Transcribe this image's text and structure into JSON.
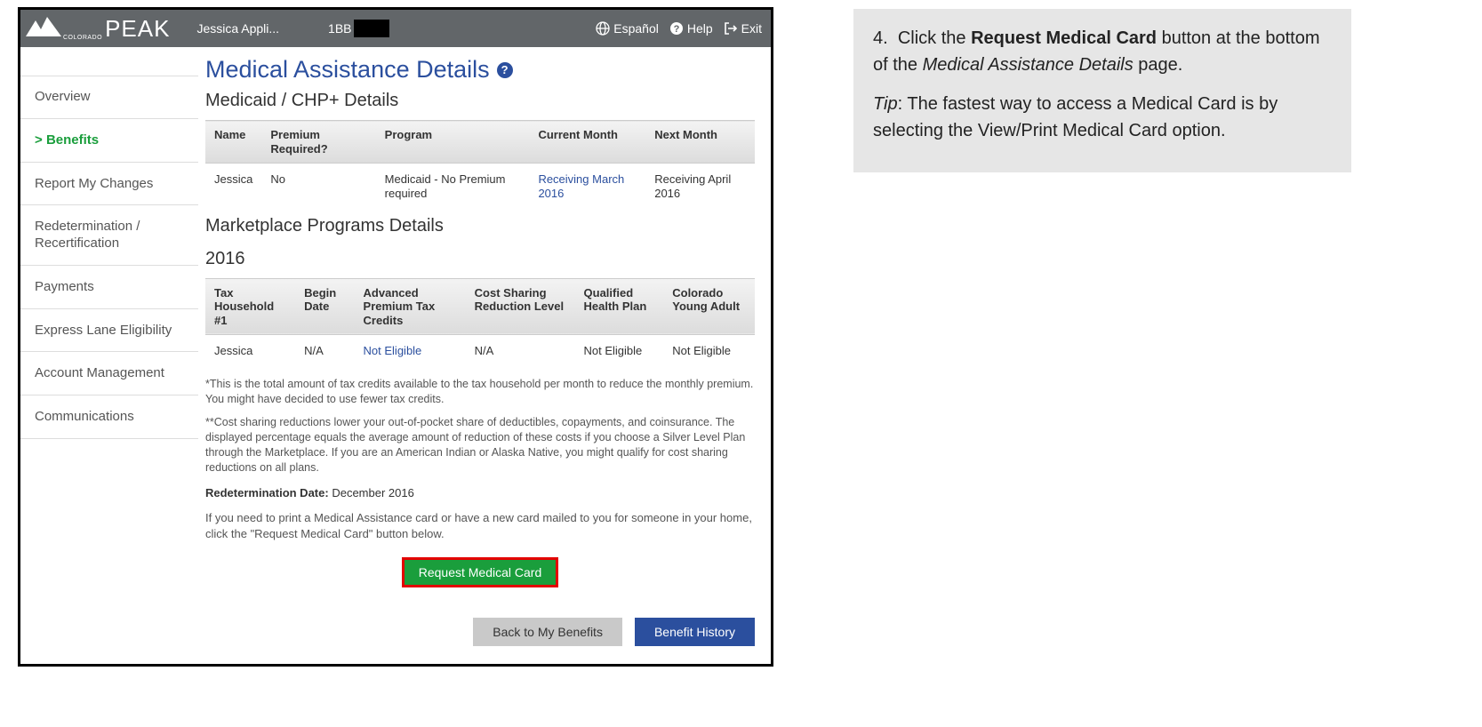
{
  "topbar": {
    "logo_small": "COLORADO",
    "logo_main": "PEAK",
    "username": "Jessica Appli...",
    "case_prefix": "1BB",
    "links": {
      "espanol": "Español",
      "help": "Help",
      "exit": "Exit"
    }
  },
  "sidebar": {
    "items": [
      {
        "label": "Overview",
        "active": false
      },
      {
        "label": "Benefits",
        "active": true
      },
      {
        "label": "Report My Changes",
        "active": false
      },
      {
        "label": "Redetermination / Recertification",
        "active": false
      },
      {
        "label": "Payments",
        "active": false
      },
      {
        "label": "Express Lane Eligibility",
        "active": false
      },
      {
        "label": "Account Management",
        "active": false
      },
      {
        "label": "Communications",
        "active": false
      }
    ]
  },
  "main": {
    "title": "Medical Assistance Details",
    "section1_title": "Medicaid / CHP+ Details",
    "table1": {
      "headers": [
        "Name",
        "Premium Required?",
        "Program",
        "Current Month",
        "Next Month"
      ],
      "row": {
        "name": "Jessica",
        "premium": "No",
        "program": "Medicaid - No Premium required",
        "current": "Receiving March 2016",
        "next": "Receiving April 2016"
      }
    },
    "section2_title": "Marketplace Programs Details",
    "year": "2016",
    "table2": {
      "headers": [
        "Tax Household #1",
        "Begin Date",
        "Advanced Premium Tax Credits",
        "Cost Sharing Reduction Level",
        "Qualified Health Plan",
        "Colorado Young Adult"
      ],
      "row": {
        "name": "Jessica",
        "begin": "N/A",
        "aptc": "Not Eligible",
        "csr": "N/A",
        "qhp": "Not Eligible",
        "cya": "Not Eligible"
      }
    },
    "footnote1": "*This is the total amount of tax credits available to the tax household per month to reduce the monthly premium. You might have decided to use fewer tax credits.",
    "footnote2": "**Cost sharing reductions lower your out-of-pocket share of deductibles, copayments, and coinsurance. The displayed percentage equals the average amount of reduction of these costs if you choose a Silver Level Plan through the Marketplace. If you are an American Indian or Alaska Native, you might qualify for cost sharing reductions on all plans.",
    "redet_label": "Redetermination Date:",
    "redet_value": "December 2016",
    "instruction": "If you need to print a Medical Assistance card or have a new card mailed to you for someone in your home, click the \"Request Medical Card\" button below.",
    "request_button": "Request Medical Card",
    "back_button": "Back to My Benefits",
    "history_button": "Benefit History"
  },
  "panel": {
    "step_num": "4.",
    "step_pre": "Click the ",
    "step_bold": "Request Medical Card",
    "step_post1": " button at the bottom of the ",
    "step_italic": "Medical Assistance Details",
    "step_post2": " page.",
    "tip_label": "Tip",
    "tip_text": ":  The fastest way to access a Medical Card is by selecting the View/Print Medical Card option."
  }
}
